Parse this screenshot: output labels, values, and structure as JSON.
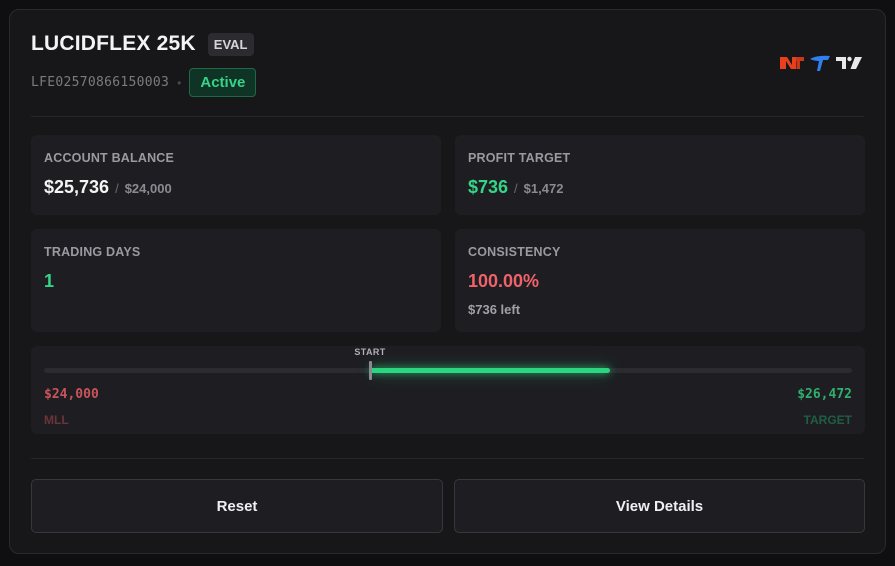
{
  "account": {
    "name": "LUCIDFLEX 25K",
    "type_badge": "EVAL",
    "id": "LFE02570866150003",
    "separator": "•",
    "status": "Active"
  },
  "platform_logos": [
    {
      "icon": "ninjatrader-logo-icon",
      "color": "#e8401c"
    },
    {
      "icon": "tradovate-logo-icon",
      "color": "#2f7ff0"
    },
    {
      "icon": "tradingview-logo-icon",
      "color": "#e8e8ea"
    }
  ],
  "stats": {
    "balance": {
      "label": "ACCOUNT BALANCE",
      "value": "$25,736",
      "sep": "/",
      "of": "$24,000"
    },
    "profit_target": {
      "label": "PROFIT TARGET",
      "value": "$736",
      "sep": "/",
      "of": "$1,472"
    },
    "trading_days": {
      "label": "TRADING DAYS",
      "value": "1"
    },
    "consistency": {
      "label": "CONSISTENCY",
      "value": "100.00%",
      "note": "$736 left"
    }
  },
  "progress": {
    "start_label": "START",
    "start_fraction": 0.404,
    "current_fraction": 0.7,
    "mll_value": "$24,000",
    "mll_label": "MLL",
    "target_value": "$26,472",
    "target_label": "TARGET"
  },
  "actions": {
    "reset": "Reset",
    "view_details": "View Details"
  },
  "colors": {
    "accent_green": "#36d488",
    "danger_red": "#f0626a",
    "background": "#17171a"
  }
}
